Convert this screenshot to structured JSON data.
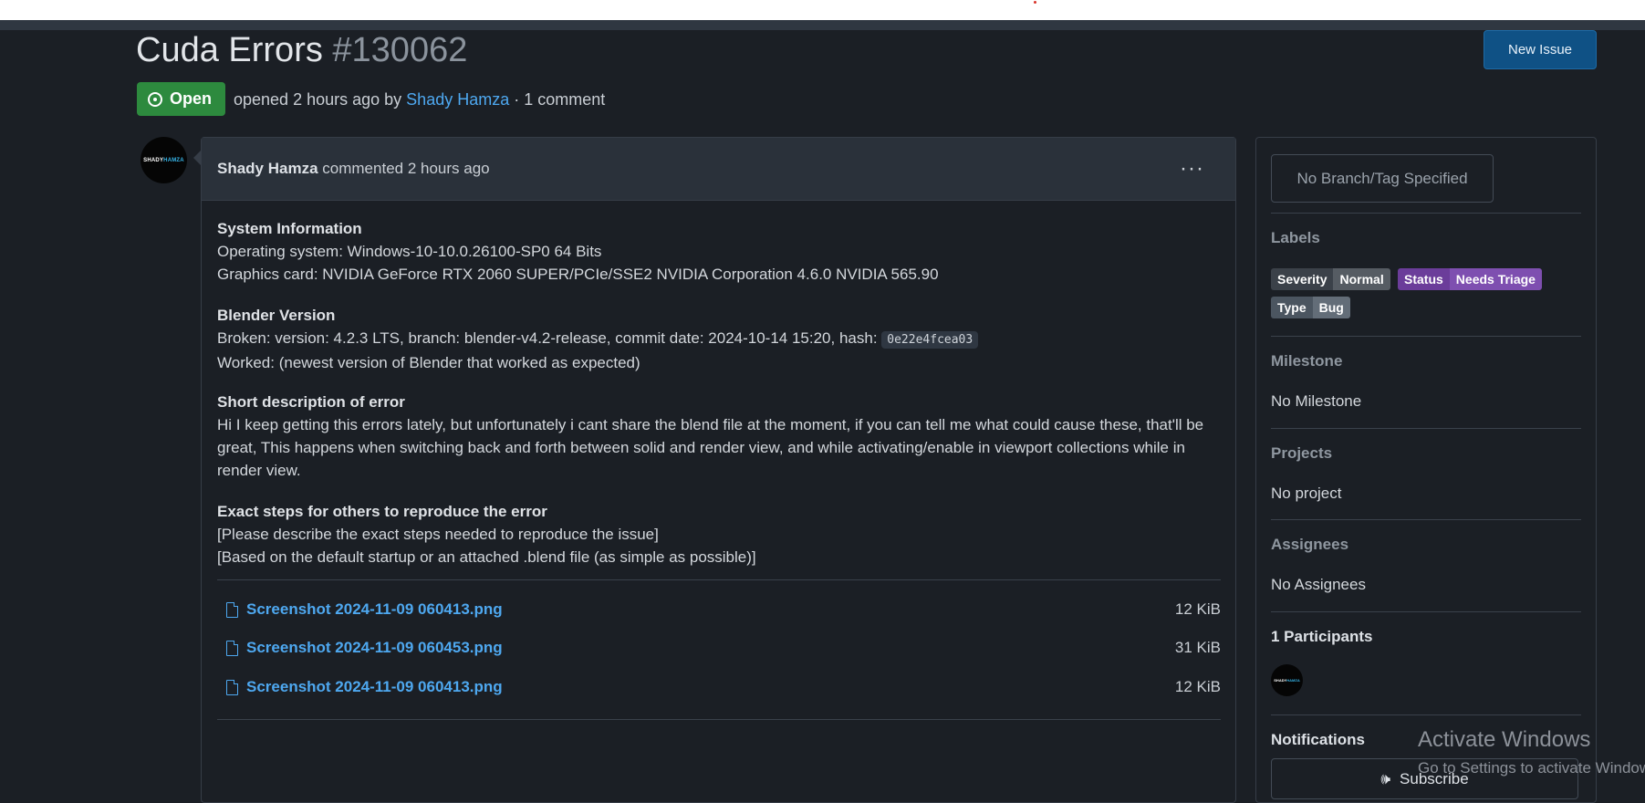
{
  "issue": {
    "title": "Cuda Errors",
    "number": "#130062",
    "status": "Open",
    "meta_opened": "opened 2 hours ago by",
    "meta_author": "Shady Hamza",
    "meta_comments": "· 1 comment",
    "new_issue_label": "New Issue"
  },
  "comment": {
    "author": "Shady Hamza",
    "action": "commented 2 hours ago",
    "more": "···",
    "avatar_text_a": "SHADY",
    "avatar_text_b": "HAMZA",
    "sections": {
      "sysinfo_heading": "System Information",
      "os": "Operating system: Windows-10-10.0.26100-SP0 64 Bits",
      "gpu": "Graphics card: NVIDIA GeForce RTX 2060 SUPER/PCIe/SSE2 NVIDIA Corporation 4.6.0 NVIDIA 565.90",
      "blender_heading": "Blender Version",
      "broken_text": "Broken: version: 4.2.3 LTS, branch: blender-v4.2-release, commit date: 2024-10-14 15:20, hash:",
      "broken_hash": "0e22e4fcea03",
      "worked": "Worked: (newest version of Blender that worked as expected)",
      "short_heading": "Short description of error",
      "short_body": "Hi I keep getting this errors lately, but unfortunately i cant share the blend file at the moment, if you can tell me what could cause these, that'll be great, This happens when switching back and forth between solid and render view, and while activating/enable in viewport collections while in render view.",
      "steps_heading": "Exact steps for others to reproduce the error",
      "steps_line1": "[Please describe the exact steps needed to reproduce the issue]",
      "steps_line2": "[Based on the default startup or an attached .blend file (as simple as possible)]"
    },
    "attachments": [
      {
        "name": "Screenshot 2024-11-09 060413.png",
        "size": "12 KiB"
      },
      {
        "name": "Screenshot 2024-11-09 060453.png",
        "size": "31 KiB"
      },
      {
        "name": "Screenshot 2024-11-09 060413.png",
        "size": "12 KiB"
      }
    ]
  },
  "sidebar": {
    "branch": "No Branch/Tag Specified",
    "labels_title": "Labels",
    "labels": [
      {
        "key": "Severity",
        "value": "Normal"
      },
      {
        "key": "Status",
        "value": "Needs Triage"
      },
      {
        "key": "Type",
        "value": "Bug"
      }
    ],
    "milestone_title": "Milestone",
    "milestone_value": "No Milestone",
    "projects_title": "Projects",
    "projects_value": "No project",
    "assignees_title": "Assignees",
    "assignees_value": "No Assignees",
    "participants_title": "1 Participants",
    "notifications_title": "Notifications",
    "subscribe_label": "Subscribe"
  },
  "watermark": {
    "line1": "Activate Windows",
    "line2": "Go to Settings to activate Windows."
  },
  "colors": {
    "background": "#1b1f25",
    "link": "#4ea8f0",
    "open_badge": "#2d8a3e",
    "new_issue_button": "#0f5185",
    "status_label": "#7e4fb0"
  }
}
